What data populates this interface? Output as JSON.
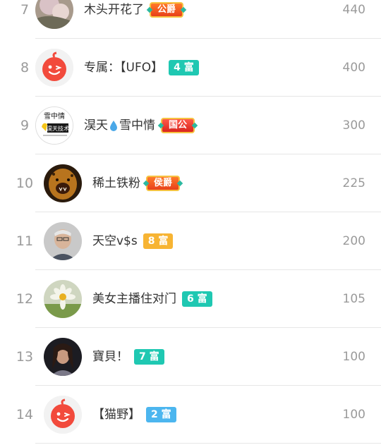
{
  "rows": [
    {
      "rank": "7",
      "name": "木头开花了",
      "badge": "公爵",
      "score": "440"
    },
    {
      "rank": "8",
      "name": "专属：【UFO】",
      "badge": "4 富",
      "score": "400"
    },
    {
      "rank": "9",
      "name_a": "淏天",
      "name_b": "雪中情",
      "badge": "国公",
      "avatar_text_top": "雪中情",
      "avatar_text_bottom": "淏天技术",
      "score": "300"
    },
    {
      "rank": "10",
      "name": "稀土铁粉",
      "badge": "侯爵",
      "score": "225"
    },
    {
      "rank": "11",
      "name": "天空v$s",
      "badge": "8 富",
      "score": "200"
    },
    {
      "rank": "12",
      "name": "美女主播住对门",
      "badge": "6 富",
      "score": "105"
    },
    {
      "rank": "13",
      "name": "寶貝！",
      "badge": "7 富",
      "score": "100"
    },
    {
      "rank": "14",
      "name": "【猫野】",
      "badge": "2 富",
      "score": "100"
    }
  ],
  "colors": {
    "rich_teal": "#1fc8b2",
    "rich_orange": "#f7b433",
    "rich_blue": "#4cb6ef",
    "noble_orange": "#ee5a1f",
    "default_avatar_red": "#f24a3c"
  }
}
